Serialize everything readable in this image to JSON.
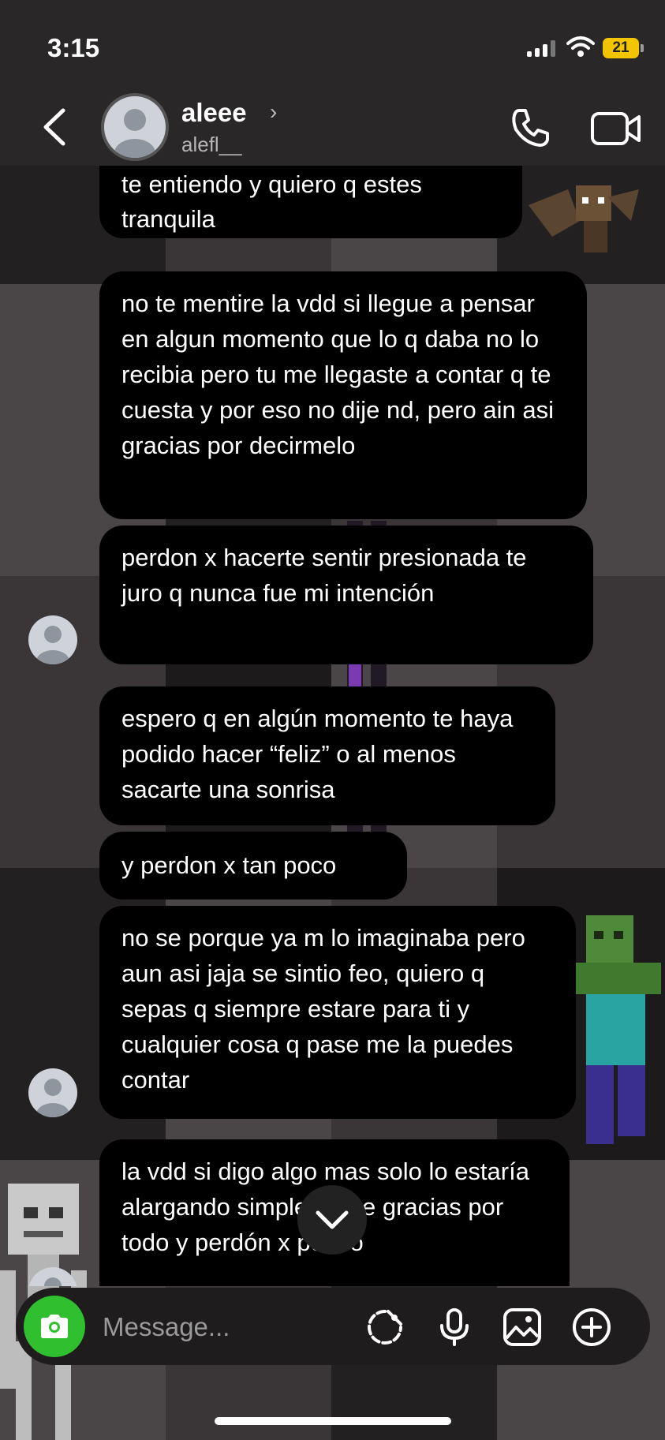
{
  "status_bar": {
    "time": "3:15",
    "battery": "21"
  },
  "header": {
    "name": "aleee",
    "username": "alefl__"
  },
  "messages": [
    {
      "text": "te entiendo y quiero q estes tranquila"
    },
    {
      "text": "no te mentire la vdd si llegue a pensar en algun momento que lo q daba no lo recibia pero tu me llegaste a contar q te cuesta y por eso no dije nd, pero ain asi gracias por decirmelo"
    },
    {
      "text": "perdon x hacerte sentir presionada te juro q nunca fue mi intención"
    },
    {
      "text": "espero q en algún momento te haya podido hacer “feliz” o al menos sacarte una sonrisa"
    },
    {
      "text": "y perdon x tan poco"
    },
    {
      "text": "no se porque ya m lo imaginaba pero aun asi jaja se sintio feo, quiero q sepas q siempre estare para ti y cualquier cosa q pase me la puedes contar"
    },
    {
      "text": "la vdd si digo algo mas solo lo estaría alargando simplemente gracias por todo y perdón x pocoo"
    }
  ],
  "composer": {
    "placeholder": "Message..."
  },
  "icons": {
    "back": "chevron-left-icon",
    "phone": "phone-icon",
    "video": "video-camera-icon",
    "camera": "camera-icon",
    "sticker": "sticker-icon",
    "mic": "microphone-icon",
    "gallery": "image-icon",
    "plus": "plus-circle-icon",
    "scroll": "chevron-down-icon"
  },
  "colors": {
    "camera_button": "#2fbf2f",
    "bubble": "#000000",
    "battery": "#f2c500"
  }
}
